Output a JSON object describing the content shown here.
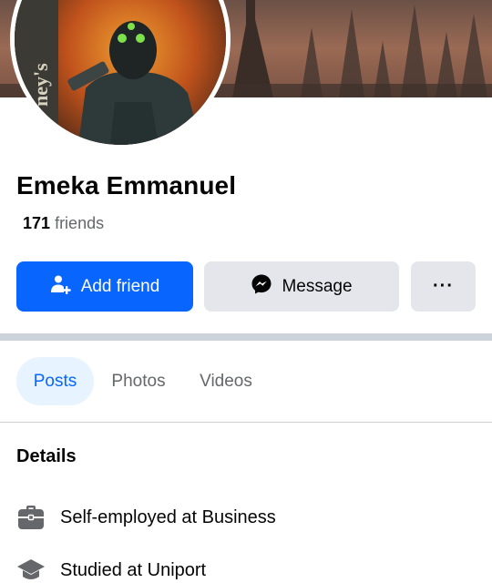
{
  "profile": {
    "name": "Emeka Emmanuel",
    "friends_count": "171",
    "friends_label": "friends",
    "avatar_edge_text": "ney's"
  },
  "actions": {
    "add_friend": "Add friend",
    "message": "Message",
    "more": "···"
  },
  "tabs": [
    {
      "label": "Posts",
      "selected": true
    },
    {
      "label": "Photos",
      "selected": false
    },
    {
      "label": "Videos",
      "selected": false
    }
  ],
  "details": {
    "title": "Details",
    "items": [
      {
        "icon": "briefcase-icon",
        "text": "Self-employed at Business"
      },
      {
        "icon": "graduation-cap-icon",
        "text": "Studied at Uniport"
      }
    ]
  },
  "colors": {
    "accent": "#0866ff",
    "secondary_button": "#e4e6eb",
    "selected_tab_bg": "#e7f3ff",
    "muted_text": "#65676b"
  }
}
